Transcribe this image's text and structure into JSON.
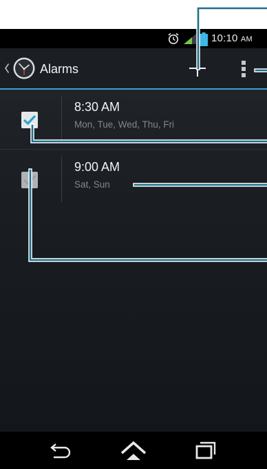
{
  "status_bar": {
    "time": "10:10",
    "ampm": "AM",
    "icons": [
      "alarm-clock-icon",
      "signal-icon",
      "battery-icon"
    ]
  },
  "action_bar": {
    "title": "Alarms",
    "icons": [
      "up-caret-icon",
      "clock-app-icon",
      "add-icon",
      "overflow-menu-icon"
    ]
  },
  "alarms": [
    {
      "time": "8:30 AM",
      "days": "Mon, Tue, Wed, Thu, Fri",
      "enabled": true
    },
    {
      "time": "9:00 AM",
      "days": "Sat, Sun",
      "enabled": false
    }
  ],
  "nav_bar": {
    "icons": [
      "back-icon",
      "home-icon",
      "recent-apps-icon"
    ]
  },
  "colors": {
    "accent": "#35a5d4",
    "callout": "#1f6f8b",
    "background": "#1a1e22",
    "check_mark": "#2aa3cf"
  }
}
